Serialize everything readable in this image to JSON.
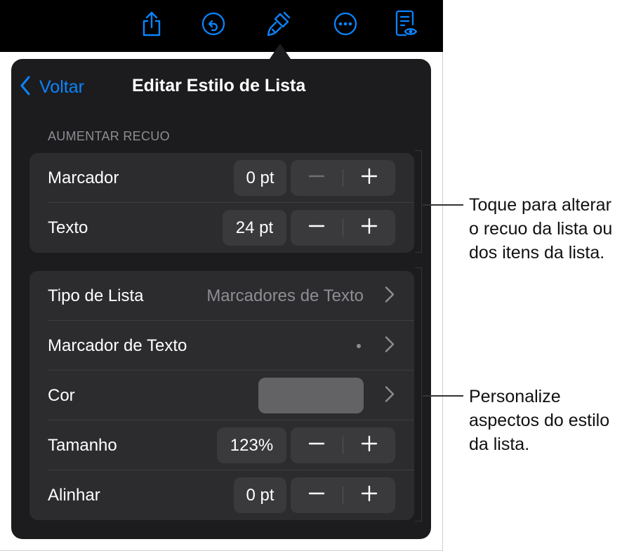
{
  "toolbar": {
    "icons": [
      "share-icon",
      "undo-icon",
      "format-brush-icon",
      "more-icon",
      "reading-view-icon"
    ],
    "accent_color": "#0a84ff"
  },
  "popover": {
    "back_label": "Voltar",
    "title": "Editar Estilo de Lista",
    "indent_section": {
      "header": "AUMENTAR RECUO",
      "rows": [
        {
          "label": "Marcador",
          "value": "0 pt"
        },
        {
          "label": "Texto",
          "value": "24 pt"
        }
      ]
    },
    "style_section": {
      "list_type": {
        "label": "Tipo de Lista",
        "value": "Marcadores de Texto"
      },
      "text_bullet": {
        "label": "Marcador de Texto",
        "value": "•"
      },
      "color": {
        "label": "Cor",
        "swatch": "#636366"
      },
      "size": {
        "label": "Tamanho",
        "value": "123%"
      },
      "align": {
        "label": "Alinhar",
        "value": "0 pt"
      }
    }
  },
  "callouts": {
    "indent": "Toque para alterar o recuo da lista ou dos itens da lista.",
    "style": "Personalize aspectos do estilo da lista."
  }
}
